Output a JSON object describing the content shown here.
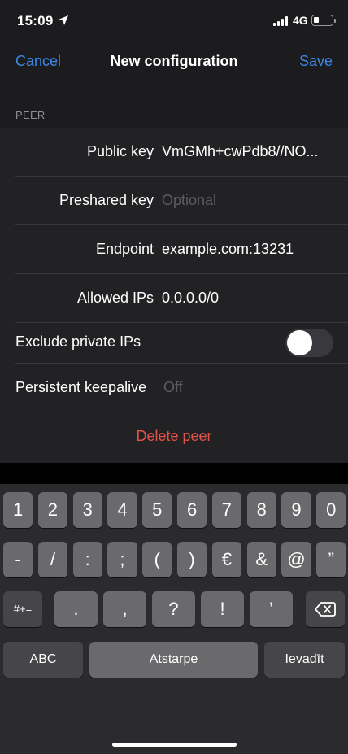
{
  "status": {
    "time": "15:09",
    "network": "4G"
  },
  "nav": {
    "cancel": "Cancel",
    "title": "New configuration",
    "save": "Save"
  },
  "section": {
    "header": "PEER"
  },
  "peer": {
    "public_key_label": "Public key",
    "public_key_value": "VmGMh+cwPdb8//NO...",
    "preshared_key_label": "Preshared key",
    "preshared_key_placeholder": "Optional",
    "endpoint_label": "Endpoint",
    "endpoint_value": "example.com:13231",
    "allowed_ips_label": "Allowed IPs",
    "allowed_ips_value": "0.0.0.0/0",
    "exclude_private_label": "Exclude private IPs",
    "exclude_private_on": false,
    "keepalive_label": "Persistent keepalive",
    "keepalive_placeholder": "Off",
    "delete_label": "Delete peer"
  },
  "keyboard": {
    "row1": [
      "1",
      "2",
      "3",
      "4",
      "5",
      "6",
      "7",
      "8",
      "9",
      "0"
    ],
    "row2": [
      "-",
      "/",
      ":",
      ";",
      "(",
      ")",
      "€",
      "&",
      "@",
      "”"
    ],
    "row3_left": "#+=",
    "row3": [
      ".",
      ",",
      "?",
      "!",
      "’"
    ],
    "abc": "ABC",
    "space": "Atstarpe",
    "return": "Ievadīt"
  },
  "colors": {
    "accent": "#3a87e6",
    "destructive": "#e2524a"
  }
}
